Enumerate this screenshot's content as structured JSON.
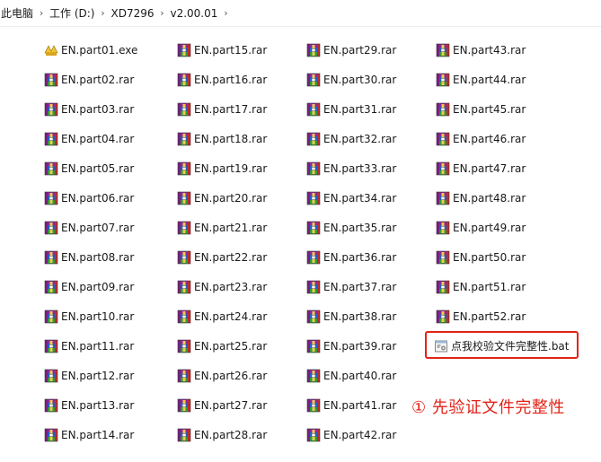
{
  "breadcrumb": {
    "items": [
      "此电脑",
      "工作 (D:)",
      "XD7296",
      "v2.00.01"
    ]
  },
  "files": [
    {
      "name": "EN.part01.exe",
      "type": "exe"
    },
    {
      "name": "EN.part02.rar",
      "type": "rar"
    },
    {
      "name": "EN.part03.rar",
      "type": "rar"
    },
    {
      "name": "EN.part04.rar",
      "type": "rar"
    },
    {
      "name": "EN.part05.rar",
      "type": "rar"
    },
    {
      "name": "EN.part06.rar",
      "type": "rar"
    },
    {
      "name": "EN.part07.rar",
      "type": "rar"
    },
    {
      "name": "EN.part08.rar",
      "type": "rar"
    },
    {
      "name": "EN.part09.rar",
      "type": "rar"
    },
    {
      "name": "EN.part10.rar",
      "type": "rar"
    },
    {
      "name": "EN.part11.rar",
      "type": "rar"
    },
    {
      "name": "EN.part12.rar",
      "type": "rar"
    },
    {
      "name": "EN.part13.rar",
      "type": "rar"
    },
    {
      "name": "EN.part14.rar",
      "type": "rar"
    },
    {
      "name": "EN.part15.rar",
      "type": "rar"
    },
    {
      "name": "EN.part16.rar",
      "type": "rar"
    },
    {
      "name": "EN.part17.rar",
      "type": "rar"
    },
    {
      "name": "EN.part18.rar",
      "type": "rar"
    },
    {
      "name": "EN.part19.rar",
      "type": "rar"
    },
    {
      "name": "EN.part20.rar",
      "type": "rar"
    },
    {
      "name": "EN.part21.rar",
      "type": "rar"
    },
    {
      "name": "EN.part22.rar",
      "type": "rar"
    },
    {
      "name": "EN.part23.rar",
      "type": "rar"
    },
    {
      "name": "EN.part24.rar",
      "type": "rar"
    },
    {
      "name": "EN.part25.rar",
      "type": "rar"
    },
    {
      "name": "EN.part26.rar",
      "type": "rar"
    },
    {
      "name": "EN.part27.rar",
      "type": "rar"
    },
    {
      "name": "EN.part28.rar",
      "type": "rar"
    },
    {
      "name": "EN.part29.rar",
      "type": "rar"
    },
    {
      "name": "EN.part30.rar",
      "type": "rar"
    },
    {
      "name": "EN.part31.rar",
      "type": "rar"
    },
    {
      "name": "EN.part32.rar",
      "type": "rar"
    },
    {
      "name": "EN.part33.rar",
      "type": "rar"
    },
    {
      "name": "EN.part34.rar",
      "type": "rar"
    },
    {
      "name": "EN.part35.rar",
      "type": "rar"
    },
    {
      "name": "EN.part36.rar",
      "type": "rar"
    },
    {
      "name": "EN.part37.rar",
      "type": "rar"
    },
    {
      "name": "EN.part38.rar",
      "type": "rar"
    },
    {
      "name": "EN.part39.rar",
      "type": "rar"
    },
    {
      "name": "EN.part40.rar",
      "type": "rar"
    },
    {
      "name": "EN.part41.rar",
      "type": "rar"
    },
    {
      "name": "EN.part42.rar",
      "type": "rar"
    },
    {
      "name": "EN.part43.rar",
      "type": "rar"
    },
    {
      "name": "EN.part44.rar",
      "type": "rar"
    },
    {
      "name": "EN.part45.rar",
      "type": "rar"
    },
    {
      "name": "EN.part46.rar",
      "type": "rar"
    },
    {
      "name": "EN.part47.rar",
      "type": "rar"
    },
    {
      "name": "EN.part48.rar",
      "type": "rar"
    },
    {
      "name": "EN.part49.rar",
      "type": "rar"
    },
    {
      "name": "EN.part50.rar",
      "type": "rar"
    },
    {
      "name": "EN.part51.rar",
      "type": "rar"
    },
    {
      "name": "EN.part52.rar",
      "type": "rar"
    },
    {
      "name": "点我校验文件完整性.bat",
      "type": "bat"
    }
  ],
  "annotation": {
    "text": "① 先验证文件完整性"
  },
  "colors": {
    "annotation": "#e22218",
    "text": "#1a1a1a"
  }
}
